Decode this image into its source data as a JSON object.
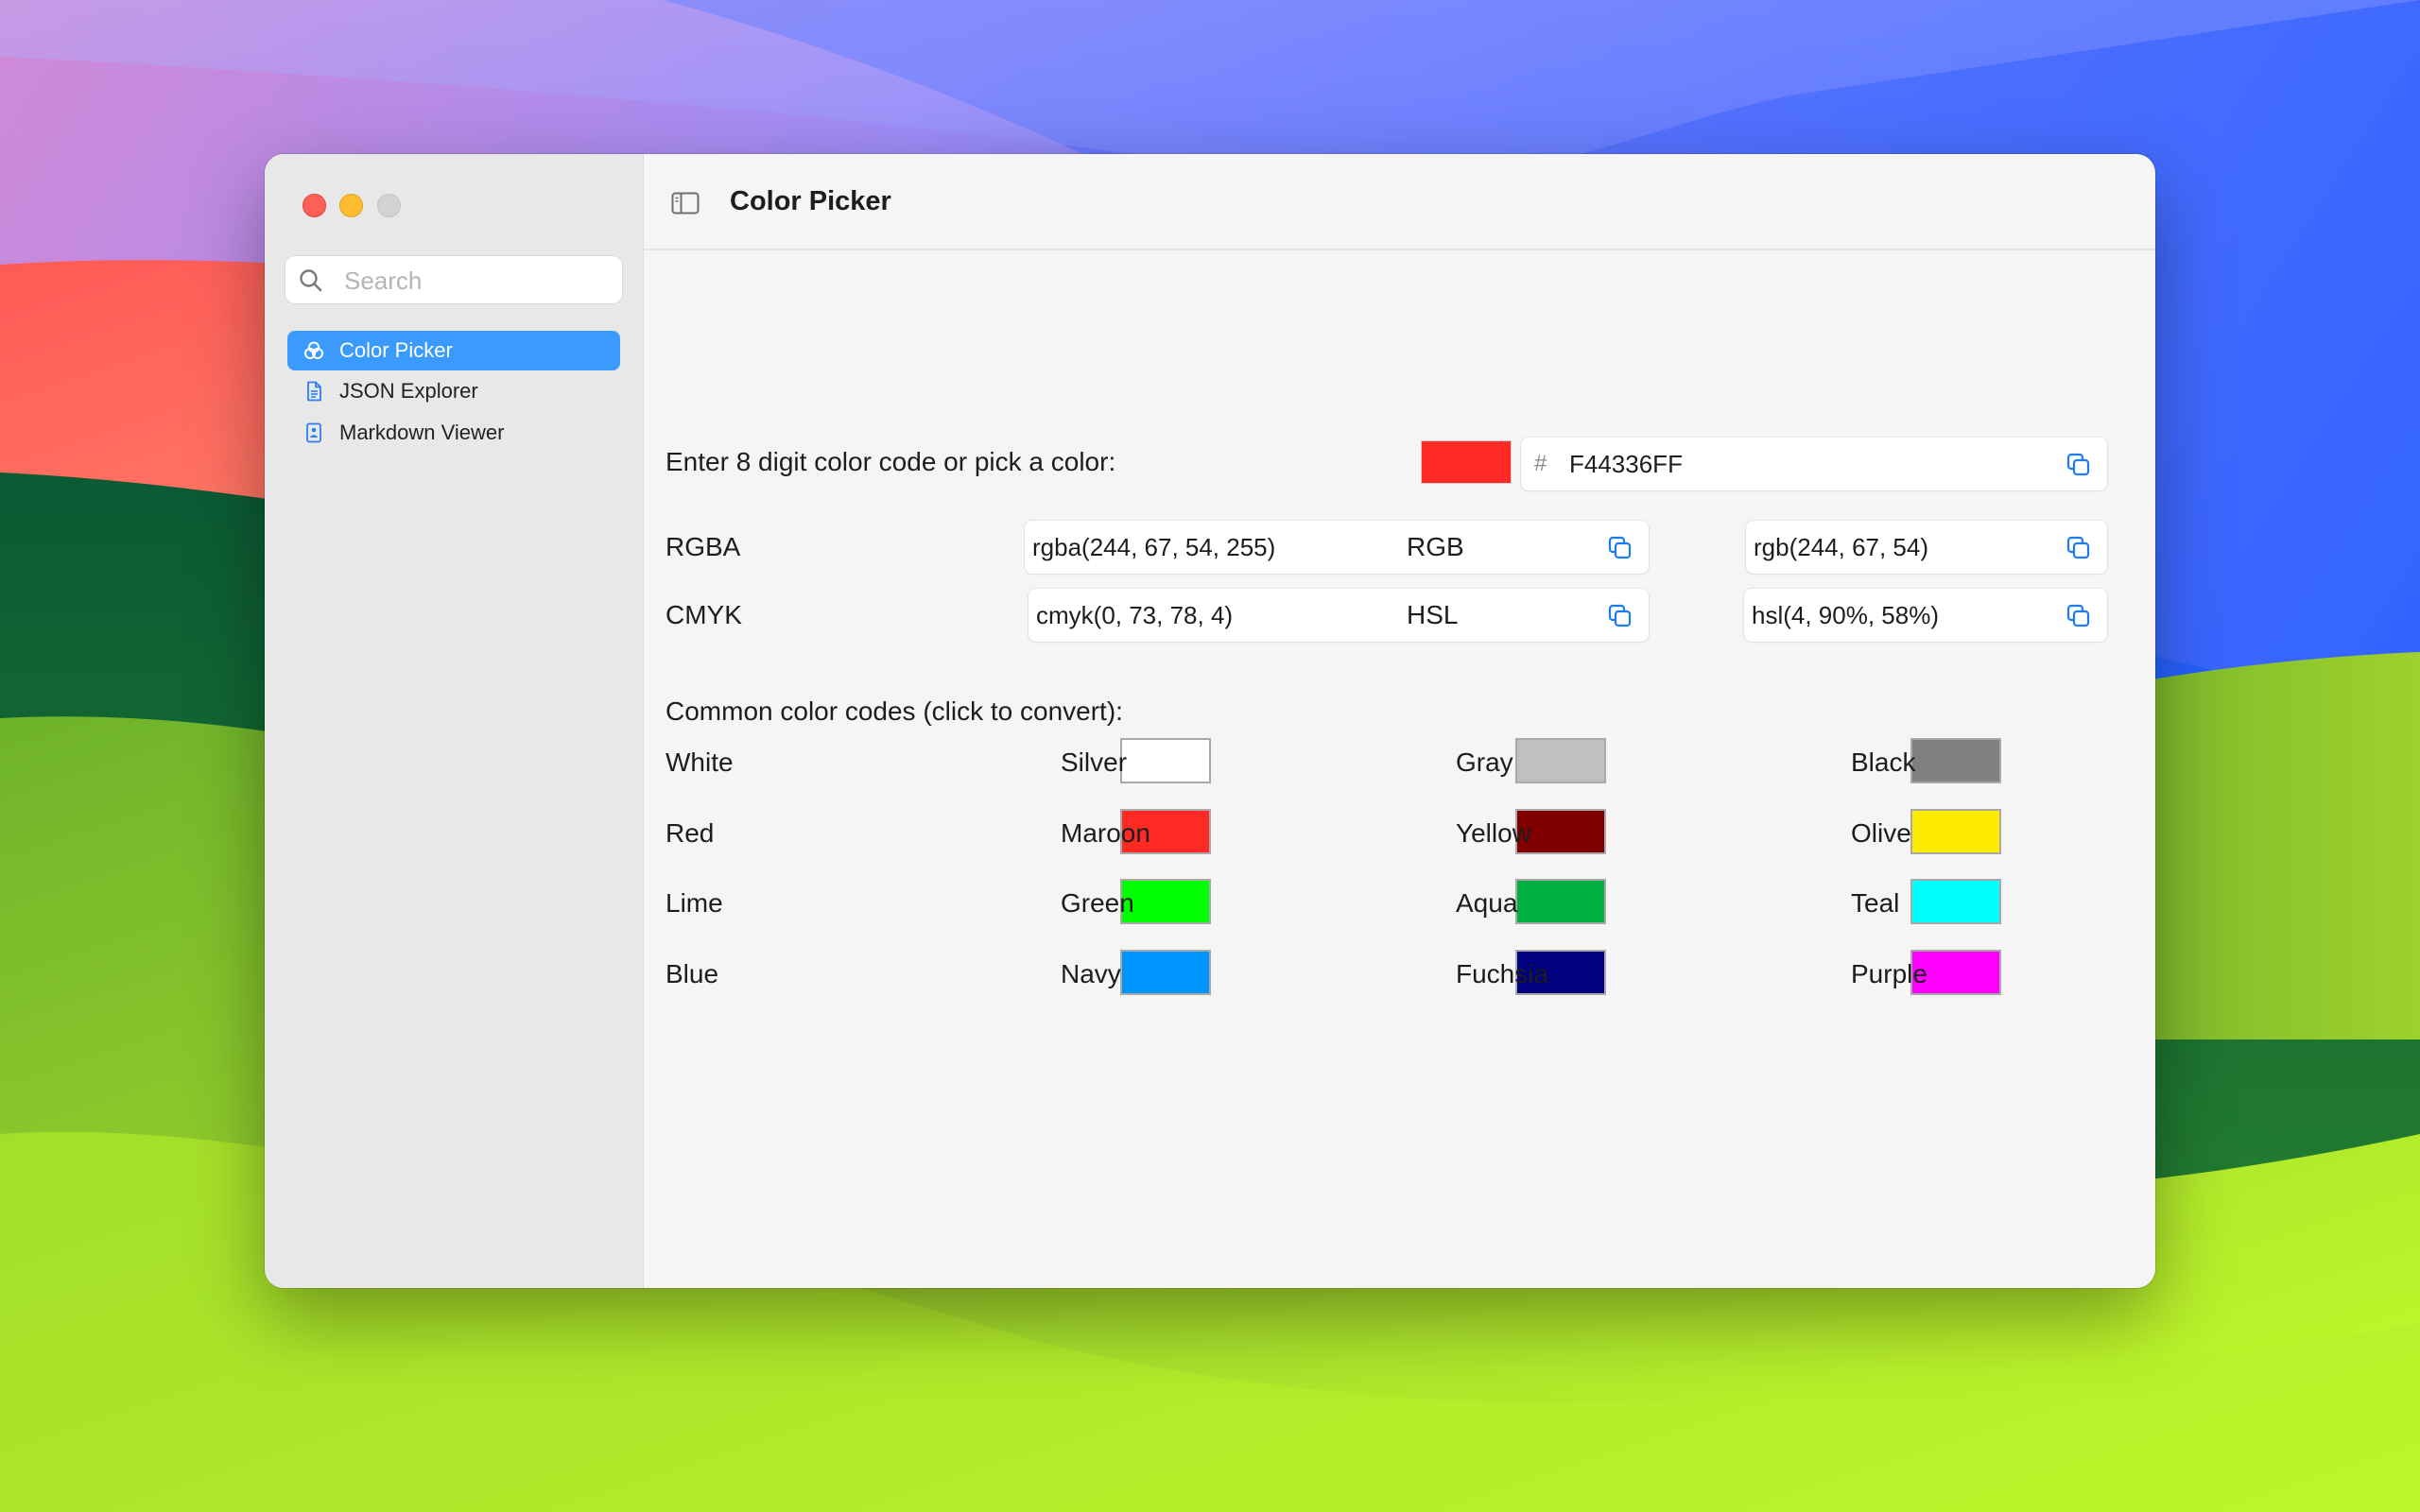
{
  "window": {
    "title": "Color Picker"
  },
  "sidebar": {
    "search_placeholder": "Search",
    "items": [
      {
        "label": "Color Picker",
        "icon": "color-circles-icon",
        "selected": true
      },
      {
        "label": "JSON Explorer",
        "icon": "document-icon",
        "selected": false
      },
      {
        "label": "Markdown Viewer",
        "icon": "image-document-icon",
        "selected": false
      }
    ]
  },
  "picker": {
    "prompt": "Enter 8 digit color code or pick a color:",
    "current_color": "#F44336",
    "hash_prefix": "#",
    "hex_value": "F44336FF"
  },
  "formats": {
    "rgba": {
      "label": "RGBA",
      "value": "rgba(244, 67, 54, 255)"
    },
    "rgb": {
      "label": "RGB",
      "value": "rgb(244, 67, 54)"
    },
    "cmyk": {
      "label": "CMYK",
      "value": "cmyk(0, 73, 78, 4)"
    },
    "hsl": {
      "label": "HSL",
      "value": "hsl(4, 90%, 58%)"
    }
  },
  "common": {
    "heading": "Common color codes (click to convert):",
    "colors": [
      {
        "name": "White",
        "hex": "#FFFFFF"
      },
      {
        "name": "Silver",
        "hex": "#C0C0C0"
      },
      {
        "name": "Gray",
        "hex": "#808080"
      },
      {
        "name": "Black",
        "hex": "#000000"
      },
      {
        "name": "Red",
        "hex": "#FF2A24"
      },
      {
        "name": "Maroon",
        "hex": "#800000"
      },
      {
        "name": "Yellow",
        "hex": "#FFEB00"
      },
      {
        "name": "Olive",
        "hex": "#808000"
      },
      {
        "name": "Lime",
        "hex": "#00FF00"
      },
      {
        "name": "Green",
        "hex": "#00B041"
      },
      {
        "name": "Aqua",
        "hex": "#00FFFF"
      },
      {
        "name": "Teal",
        "hex": "#008080"
      },
      {
        "name": "Blue",
        "hex": "#0094FF"
      },
      {
        "name": "Navy",
        "hex": "#000080"
      },
      {
        "name": "Fuchsia",
        "hex": "#FF00FF"
      },
      {
        "name": "Purple",
        "hex": "#800080"
      }
    ]
  },
  "colors": {
    "accent": "#3A9BFC",
    "copy_icon": "#1E7CF2"
  }
}
